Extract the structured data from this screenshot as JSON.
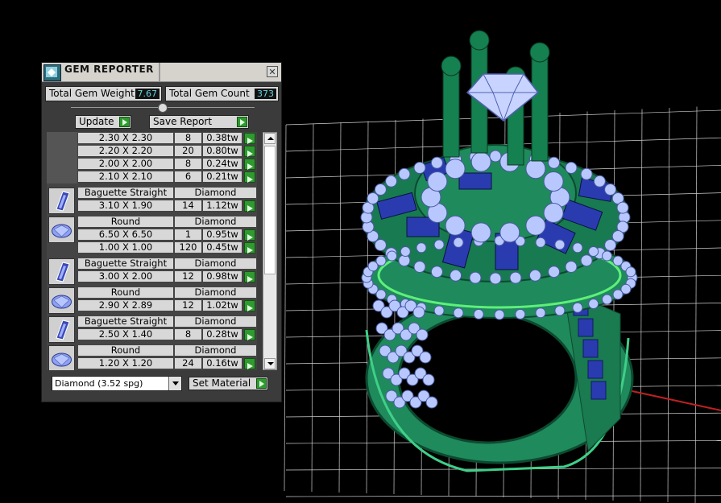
{
  "panel": {
    "title": "GEM REPORTER",
    "close_glyph": "✕",
    "total_weight_label": "Total Gem Weight",
    "total_weight_value": "7.67",
    "total_count_label": "Total Gem Count",
    "total_count_value": "373",
    "update_label": "Update",
    "save_report_label": "Save Report",
    "material_select_value": "Diamond     (3.52 spg)",
    "set_material_label": "Set Material"
  },
  "gem_groups": [
    {
      "shape": "",
      "material": "",
      "rows": [
        {
          "size": "2.30 X 2.30",
          "count": "8",
          "weight": "0.38tw"
        },
        {
          "size": "2.20 X 2.20",
          "count": "20",
          "weight": "0.80tw"
        },
        {
          "size": "2.00 X 2.00",
          "count": "8",
          "weight": "0.24tw"
        },
        {
          "size": "2.10 X 2.10",
          "count": "6",
          "weight": "0.21tw"
        }
      ]
    },
    {
      "shape": "Baguette Straight",
      "material": "Diamond",
      "icon": "baguette-icon",
      "rows": [
        {
          "size": "3.10 X 1.90",
          "count": "14",
          "weight": "1.12tw"
        }
      ]
    },
    {
      "shape": "Round",
      "material": "Diamond",
      "icon": "round-gem-icon",
      "rows": [
        {
          "size": "6.50 X 6.50",
          "count": "1",
          "weight": "0.95tw"
        },
        {
          "size": "1.00 X 1.00",
          "count": "120",
          "weight": "0.45tw"
        }
      ]
    },
    {
      "shape": "Baguette Straight",
      "material": "Diamond",
      "icon": "baguette-icon",
      "rows": [
        {
          "size": "3.00 X 2.00",
          "count": "12",
          "weight": "0.98tw"
        }
      ]
    },
    {
      "shape": "Round",
      "material": "Diamond",
      "icon": "round-gem-icon",
      "rows": [
        {
          "size": "2.90 X 2.89",
          "count": "12",
          "weight": "1.02tw"
        }
      ]
    },
    {
      "shape": "Baguette Straight",
      "material": "Diamond",
      "icon": "baguette-icon",
      "rows": [
        {
          "size": "2.50 X 1.40",
          "count": "8",
          "weight": "0.28tw"
        }
      ]
    },
    {
      "shape": "Round",
      "material": "Diamond",
      "icon": "round-gem-icon",
      "rows": [
        {
          "size": "1.20 X 1.20",
          "count": "24",
          "weight": "0.16tw"
        }
      ]
    }
  ],
  "colors": {
    "ring_green": "#1f8a5c",
    "gem_blue": "#9fb8ff",
    "sapphire": "#2a3bb0",
    "grid": "#d0d0d0",
    "axis_red": "#c02020",
    "accept_green": "#2f9a2f"
  }
}
